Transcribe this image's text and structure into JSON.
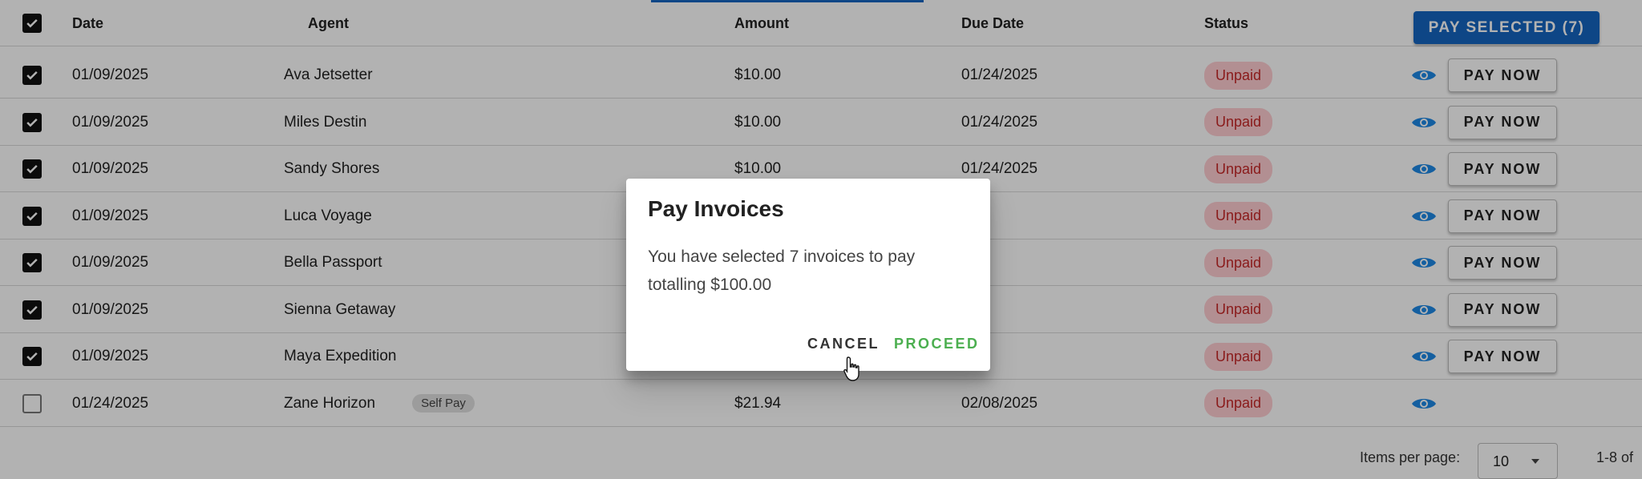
{
  "toolbar": {
    "pay_selected_label": "PAY SELECTED (7)"
  },
  "table": {
    "headers": {
      "date": "Date",
      "agent": "Agent",
      "amount": "Amount",
      "due_date": "Due Date",
      "status": "Status"
    },
    "header_checked": true,
    "rows": [
      {
        "checked": true,
        "date": "01/09/2025",
        "agent": "Ava Jetsetter",
        "badge": "",
        "amount": "$10.00",
        "due_date": "01/24/2025",
        "status": "Unpaid",
        "pay_now": "PAY NOW"
      },
      {
        "checked": true,
        "date": "01/09/2025",
        "agent": "Miles Destin",
        "badge": "",
        "amount": "$10.00",
        "due_date": "01/24/2025",
        "status": "Unpaid",
        "pay_now": "PAY NOW"
      },
      {
        "checked": true,
        "date": "01/09/2025",
        "agent": "Sandy Shores",
        "badge": "",
        "amount": "$10.00",
        "due_date": "01/24/2025",
        "status": "Unpaid",
        "pay_now": "PAY NOW"
      },
      {
        "checked": true,
        "date": "01/09/2025",
        "agent": "Luca Voyage",
        "badge": "",
        "amount": "",
        "due_date": "",
        "status": "Unpaid",
        "pay_now": "PAY NOW"
      },
      {
        "checked": true,
        "date": "01/09/2025",
        "agent": "Bella Passport",
        "badge": "",
        "amount": "",
        "due_date": "",
        "status": "Unpaid",
        "pay_now": "PAY NOW"
      },
      {
        "checked": true,
        "date": "01/09/2025",
        "agent": "Sienna Getaway",
        "badge": "",
        "amount": "",
        "due_date": "",
        "status": "Unpaid",
        "pay_now": "PAY NOW"
      },
      {
        "checked": true,
        "date": "01/09/2025",
        "agent": "Maya Expedition",
        "badge": "",
        "amount": "",
        "due_date": "",
        "status": "Unpaid",
        "pay_now": "PAY NOW"
      },
      {
        "checked": false,
        "date": "01/24/2025",
        "agent": "Zane Horizon",
        "badge": "Self Pay",
        "amount": "$21.94",
        "due_date": "02/08/2025",
        "status": "Unpaid",
        "pay_now": ""
      }
    ]
  },
  "pagination": {
    "items_per_page_label": "Items per page:",
    "items_per_page_value": "10",
    "range": "1-8 of"
  },
  "dialog": {
    "title": "Pay Invoices",
    "body": "You have selected 7 invoices to pay totalling $100.00",
    "cancel_label": "CANCEL",
    "proceed_label": "PROCEED"
  },
  "colors": {
    "primary": "#1565c0",
    "unpaid_bg": "#ffcdd2",
    "unpaid_text": "#c62828",
    "proceed": "#4caf50",
    "eye": "#1e88e5"
  }
}
